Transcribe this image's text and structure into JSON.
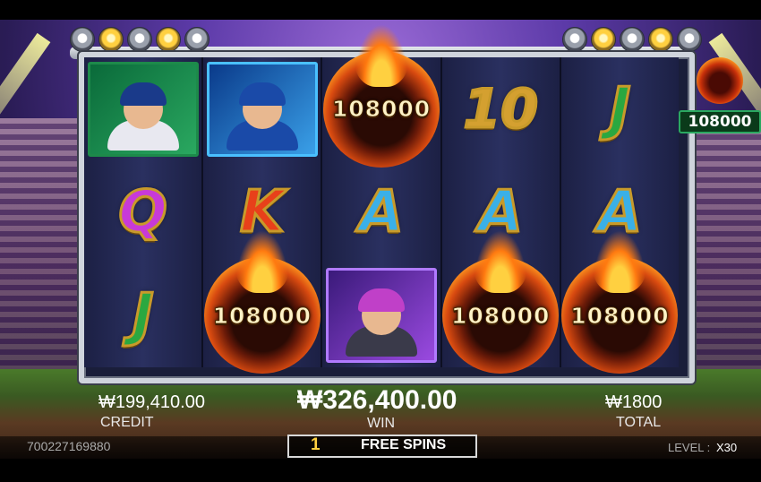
{
  "reels": [
    [
      "player-runner",
      "Q",
      "J"
    ],
    [
      "player-pitcher",
      "K",
      "fire:108000"
    ],
    [
      "fire:108000",
      "A",
      "player-catcher"
    ],
    [
      "10",
      "A",
      "fire:108000"
    ],
    [
      "J",
      "A",
      "fire:108000"
    ]
  ],
  "symbols": {
    "fire_value": "108000",
    "letters": {
      "Q": {
        "text": "Q",
        "color": "#c83ad8"
      },
      "K": {
        "text": "K",
        "color": "#e8401a"
      },
      "A": {
        "text": "A",
        "color": "#3ab0e8"
      },
      "J": {
        "text": "J",
        "color": "#2aa840"
      },
      "10": {
        "text": "10",
        "color": "#d4a030"
      }
    }
  },
  "side_jackpot": {
    "value": "108000"
  },
  "credit": {
    "amount": "₩199,410.00",
    "label": "CREDIT"
  },
  "win": {
    "amount": "₩326,400.00",
    "label": "WIN"
  },
  "total": {
    "amount": "₩1800",
    "label": "TOTAL"
  },
  "session_id": "700227169880",
  "free_spins": {
    "count": "1",
    "label": "FREE SPINS"
  },
  "level": {
    "label": "LEVEL :",
    "value": "X30"
  },
  "colors": {
    "free_spin_count": "#ffd040",
    "frame": "#cfd4dc"
  }
}
